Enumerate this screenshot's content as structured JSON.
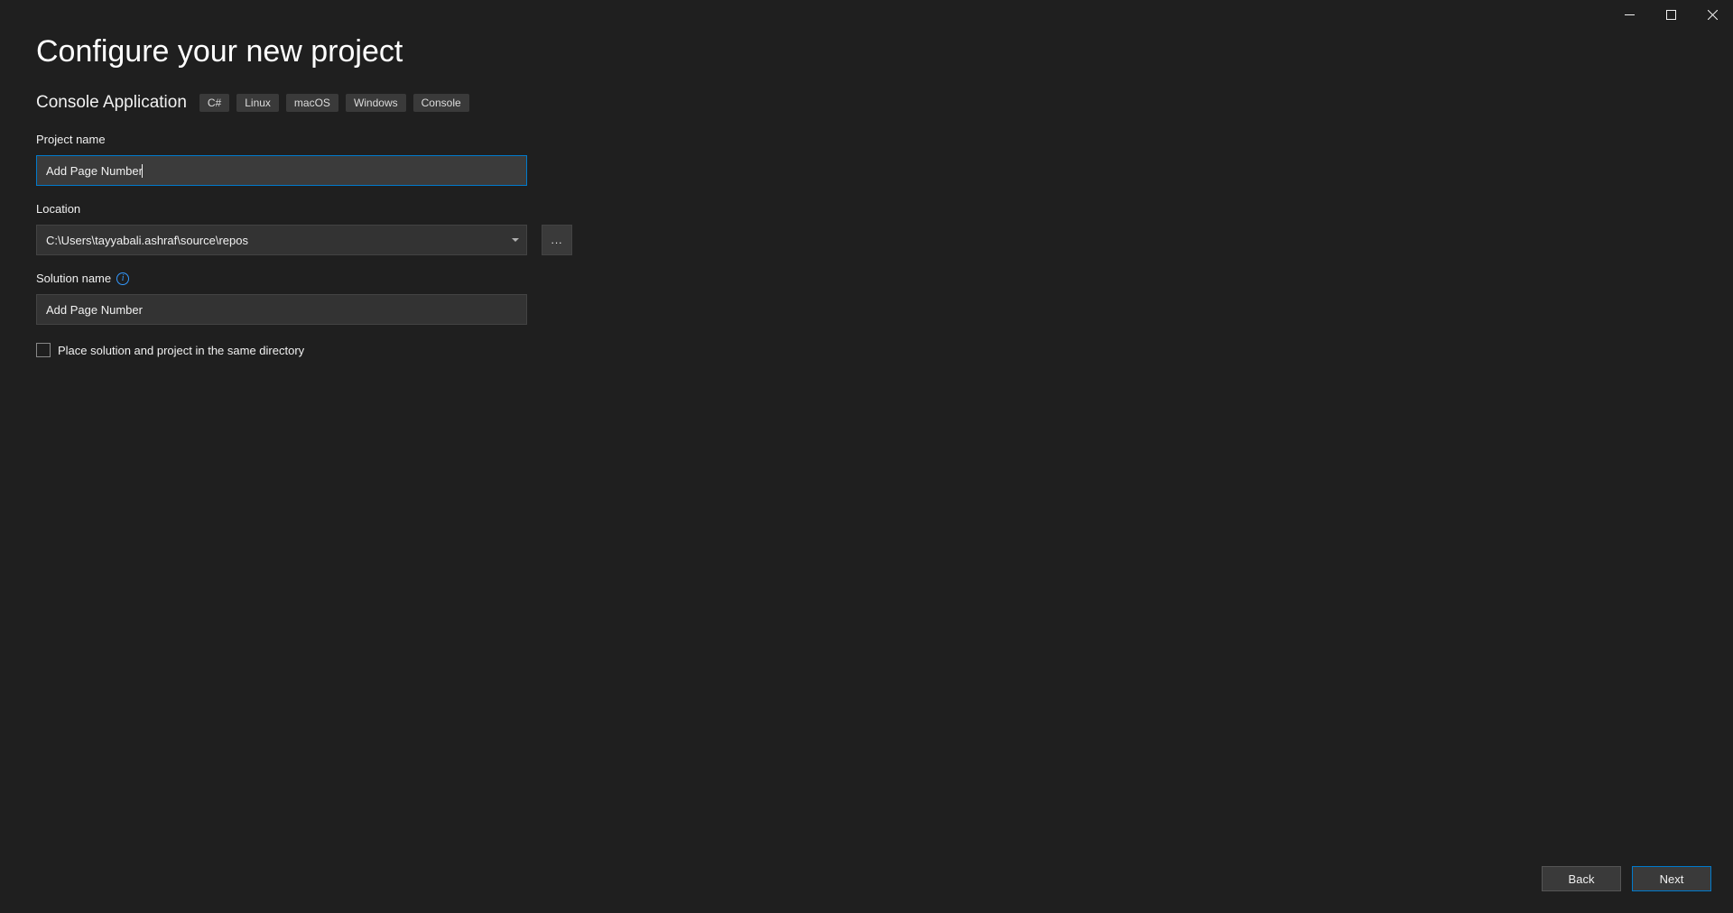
{
  "header": {
    "title": "Configure your new project",
    "subtitle": "Console Application",
    "tags": [
      "C#",
      "Linux",
      "macOS",
      "Windows",
      "Console"
    ]
  },
  "form": {
    "project_name": {
      "label": "Project name",
      "value": "Add Page Number"
    },
    "location": {
      "label": "Location",
      "value": "C:\\Users\\tayyabali.ashraf\\source\\repos",
      "browse_label": "..."
    },
    "solution_name": {
      "label": "Solution name",
      "value": "Add Page Number"
    },
    "same_directory": {
      "label": "Place solution and project in the same directory",
      "checked": false
    }
  },
  "footer": {
    "back_label": "Back",
    "next_label": "Next"
  }
}
